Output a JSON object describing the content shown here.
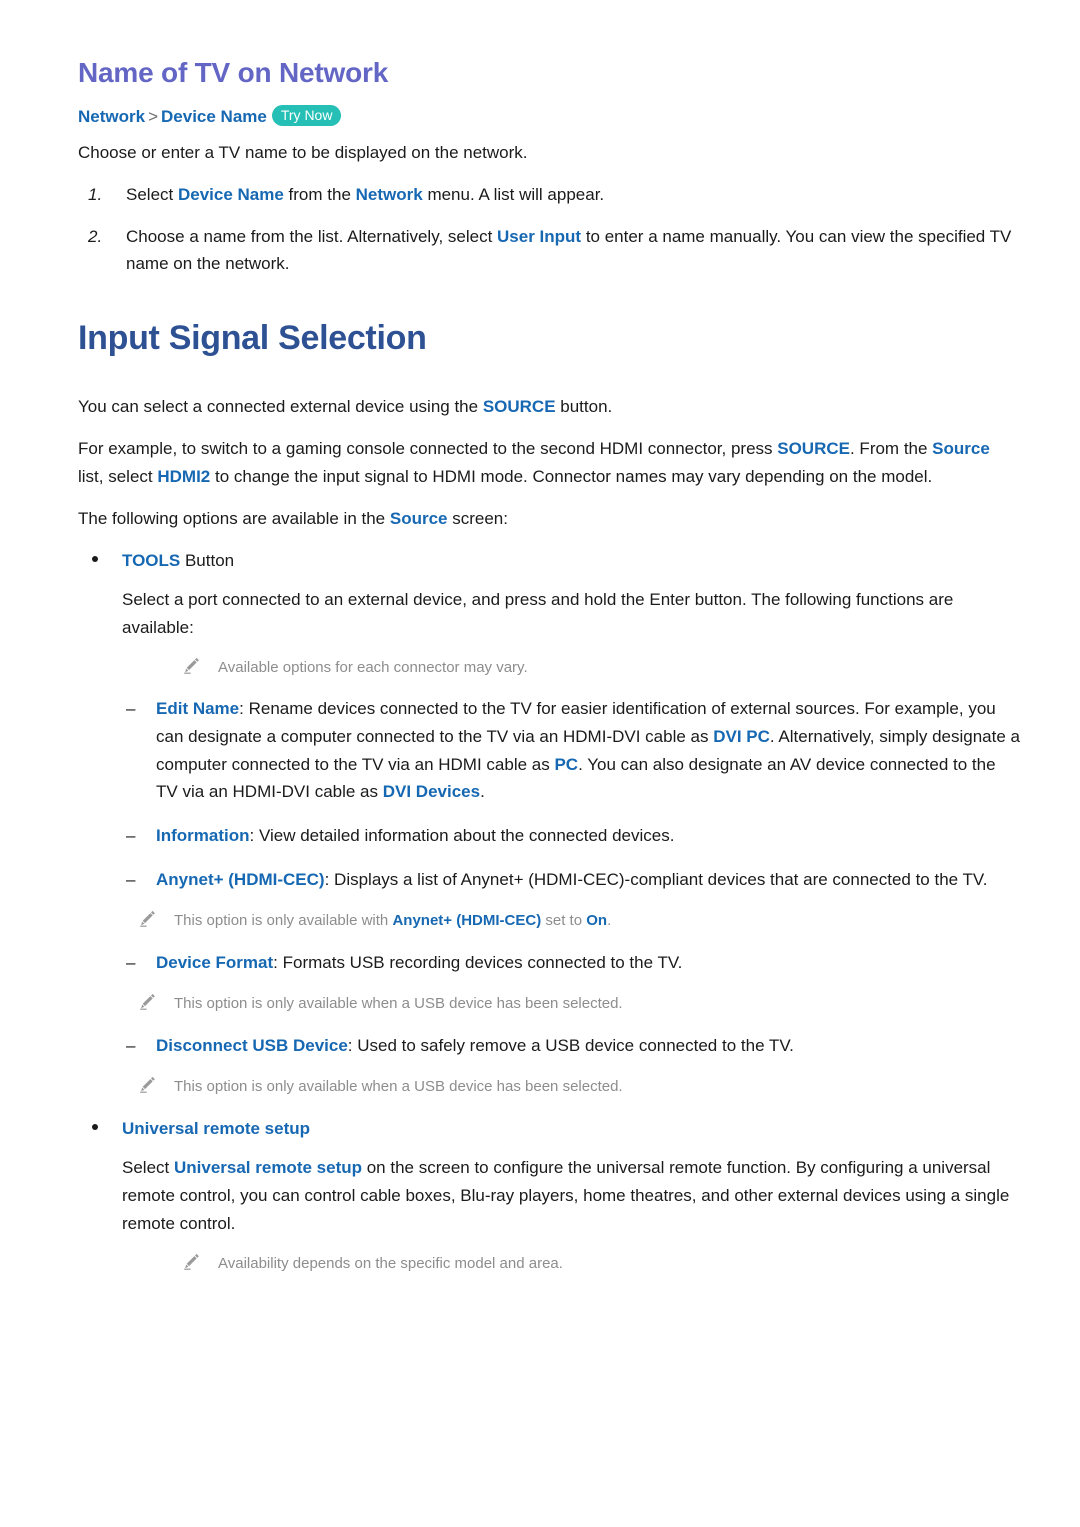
{
  "document": {
    "section1": {
      "title": "Name of TV on Network",
      "breadcrumb": {
        "first": "Network",
        "separator": ">",
        "second": "Device Name",
        "badge": "Try Now"
      },
      "intro": "Choose or enter a TV name to be displayed on the network.",
      "steps": [
        {
          "num": "1.",
          "parts": [
            {
              "text": "Select ",
              "style": "plain"
            },
            {
              "text": "Device Name",
              "style": "kw-b"
            },
            {
              "text": " from the ",
              "style": "plain"
            },
            {
              "text": "Network",
              "style": "kw-b"
            },
            {
              "text": " menu. A list will appear.",
              "style": "plain"
            }
          ]
        },
        {
          "num": "2.",
          "parts": [
            {
              "text": "Choose a name from the list. Alternatively, select ",
              "style": "plain"
            },
            {
              "text": "User Input",
              "style": "kw-b"
            },
            {
              "text": " to enter a name manually. You can view the specified TV name on the network.",
              "style": "plain"
            }
          ]
        }
      ]
    },
    "section2": {
      "title": "Input Signal Selection",
      "paragraphs": [
        [
          {
            "text": "You can select a connected external device using the ",
            "style": "plain"
          },
          {
            "text": "SOURCE",
            "style": "kw-b"
          },
          {
            "text": " button.",
            "style": "plain"
          }
        ],
        [
          {
            "text": "For example, to switch to a gaming console connected to the second HDMI connector, press ",
            "style": "plain"
          },
          {
            "text": "SOURCE",
            "style": "kw-b"
          },
          {
            "text": ". From the ",
            "style": "plain"
          },
          {
            "text": "Source",
            "style": "kw-b"
          },
          {
            "text": " list, select ",
            "style": "plain"
          },
          {
            "text": "HDMI2",
            "style": "kw-b"
          },
          {
            "text": " to change the input signal to HDMI mode. Connector names may vary depending on the model.",
            "style": "plain"
          }
        ],
        [
          {
            "text": "The following options are available in the ",
            "style": "plain"
          },
          {
            "text": "Source",
            "style": "kw-b"
          },
          {
            "text": " screen:",
            "style": "plain"
          }
        ]
      ],
      "bullets": [
        {
          "head": [
            {
              "text": "TOOLS",
              "style": "kw-b"
            },
            {
              "text": " Button",
              "style": "plain"
            }
          ],
          "head_all_blue": false,
          "body": [
            [
              {
                "text": "Select a port connected to an external device, and press and hold the Enter button. The following functions are available:",
                "style": "plain"
              }
            ]
          ],
          "note_after_body": [
            {
              "text": "Available options for each connector may vary.",
              "style": "plain"
            }
          ],
          "dashes": [
            {
              "parts": [
                {
                  "text": "Edit Name",
                  "style": "kw-b"
                },
                {
                  "text": ": Rename devices connected to the TV for easier identification of external sources. For example, you can designate a computer connected to the TV via an HDMI-DVI cable as ",
                  "style": "plain"
                },
                {
                  "text": "DVI PC",
                  "style": "kw-b"
                },
                {
                  "text": ". Alternatively, simply designate a computer connected to the TV via an HDMI cable as ",
                  "style": "plain"
                },
                {
                  "text": "PC",
                  "style": "kw-b"
                },
                {
                  "text": ". You can also designate an AV device connected to the TV via an HDMI-DVI cable as ",
                  "style": "plain"
                },
                {
                  "text": "DVI Devices",
                  "style": "kw-b"
                },
                {
                  "text": ".",
                  "style": "plain"
                }
              ],
              "note": null
            },
            {
              "parts": [
                {
                  "text": "Information",
                  "style": "kw-b"
                },
                {
                  "text": ": View detailed information about the connected devices.",
                  "style": "plain"
                }
              ],
              "note": null
            },
            {
              "parts": [
                {
                  "text": "Anynet+ (HDMI-CEC)",
                  "style": "kw-b"
                },
                {
                  "text": ": Displays a list of Anynet+ (HDMI-CEC)-compliant devices that are connected to the TV.",
                  "style": "plain"
                }
              ],
              "note": [
                {
                  "text": "This option is only available with ",
                  "style": "plain"
                },
                {
                  "text": "Anynet+ (HDMI-CEC)",
                  "style": "kw-b"
                },
                {
                  "text": " set to ",
                  "style": "plain"
                },
                {
                  "text": "On",
                  "style": "kw-b"
                },
                {
                  "text": ".",
                  "style": "plain"
                }
              ]
            },
            {
              "parts": [
                {
                  "text": "Device Format",
                  "style": "kw-b"
                },
                {
                  "text": ": Formats USB recording devices connected to the TV.",
                  "style": "plain"
                }
              ],
              "note": [
                {
                  "text": "This option is only available when a USB device has been selected.",
                  "style": "plain"
                }
              ]
            },
            {
              "parts": [
                {
                  "text": "Disconnect USB Device",
                  "style": "kw-b"
                },
                {
                  "text": ": Used to safely remove a USB device connected to the TV.",
                  "style": "plain"
                }
              ],
              "note": [
                {
                  "text": "This option is only available when a USB device has been selected.",
                  "style": "plain"
                }
              ]
            }
          ]
        },
        {
          "head": [
            {
              "text": "Universal remote setup",
              "style": "kw-b"
            }
          ],
          "head_all_blue": true,
          "body": [
            [
              {
                "text": "Select ",
                "style": "plain"
              },
              {
                "text": "Universal remote setup",
                "style": "kw-b"
              },
              {
                "text": " on the screen to configure the universal remote function. By configuring a universal remote control, you can control cable boxes, Blu-ray players, home theatres, and other external devices using a single remote control.",
                "style": "plain"
              }
            ]
          ],
          "note_after_body": [
            {
              "text": "Availability depends on the specific model and area.",
              "style": "plain"
            }
          ],
          "dashes": []
        }
      ]
    }
  },
  "colors": {
    "title_sub": "#6366c4",
    "title_main": "#2e5194",
    "keyword_blue": "#1768b3",
    "badge_teal": "#25bfb5",
    "note_gray": "#8d8d8d",
    "body_text": "#1b1b1b"
  },
  "icons": {
    "pencil": "pencil-icon",
    "bullet": "bullet-dot",
    "dash": "–"
  }
}
